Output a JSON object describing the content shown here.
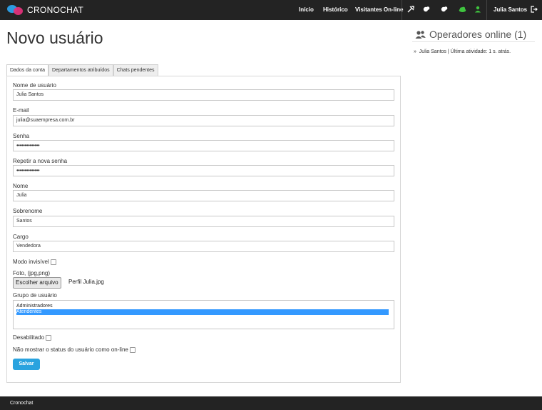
{
  "app": {
    "brand": "CRONOCHAT"
  },
  "nav": {
    "inicio": "Início",
    "historico": "Histórico",
    "visitantes": "Visitantes On-line",
    "user": "Julia Santos",
    "icons": [
      "tools-icon",
      "chat-icon",
      "chat-icon",
      "cloud-icon",
      "person-icon",
      "logout-icon"
    ]
  },
  "page": {
    "title": "Novo usuário"
  },
  "tabs": [
    "Dados da conta",
    "Departamentos atribuídos",
    "Chats pendentes"
  ],
  "form": {
    "username_label": "Nome de usuário",
    "username_value": "Julia Santos",
    "email_label": "E-mail",
    "email_value": "julia@suaempresa.com.br",
    "password_label": "Senha",
    "password_value": "••••••••••••••",
    "password2_label": "Repetir a nova senha",
    "password2_value": "••••••••••••••",
    "nome_label": "Nome",
    "nome_value": "Julia",
    "sobrenome_label": "Sobrenome",
    "sobrenome_value": "Santos",
    "cargo_label": "Cargo",
    "cargo_value": "Vendedora",
    "invisible_label": "Modo invisível",
    "foto_label": "Foto, (jpg,png)",
    "file_button": "Escolher arquivo",
    "file_name": "Perfil Julia.jpg",
    "grupo_label": "Grupo de usuário",
    "grupo_options": [
      "Administradores",
      "Atendentes"
    ],
    "grupo_selected": "Atendentes",
    "disabled_label": "Desabilitado",
    "hide_status_label": "Não mostrar o status do usuário como on-line",
    "save_button": "Salvar"
  },
  "sidebar": {
    "title": "Operadores online (1)",
    "items": [
      "Julia Santos | Última atividade: 1 s. atrás."
    ]
  },
  "footer": {
    "text": "Cronochat"
  },
  "colors": {
    "topbar": "#232323",
    "accent": "#29a3df",
    "online_green": "#3fc43f",
    "selection": "#3399ff"
  }
}
